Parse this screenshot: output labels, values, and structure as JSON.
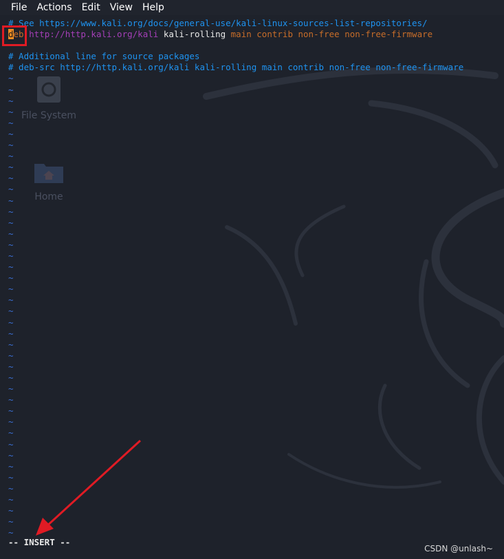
{
  "menubar": {
    "items": [
      "File",
      "Actions",
      "Edit",
      "View",
      "Help"
    ]
  },
  "desktop": {
    "icons": [
      {
        "label": "File System",
        "icon": "disc-icon"
      },
      {
        "label": "Home",
        "icon": "home-folder-icon"
      }
    ]
  },
  "editor": {
    "line1": {
      "prefix": "# See ",
      "link": "https://www.kali.org/docs/general-use/kali-linux-sources-list-repositories/"
    },
    "line2": {
      "cursor_char": "d",
      "keyword_rest": "eb",
      "url": "http://http.kali.org/kali",
      "suite": "kali-rolling",
      "components": "main contrib non-free non-free-firmware"
    },
    "line4": "# Additional line for source packages",
    "line5": "# deb-src http://http.kali.org/kali kali-rolling main contrib non-free non-free-firmware",
    "tilde_char": "~",
    "empty_line_count": 42
  },
  "status": {
    "mode": "-- INSERT --"
  },
  "watermark": "CSDN @unlash~",
  "colors": {
    "background": "#1e222b",
    "comment": "#1e93f0",
    "keyword": "#c76d29",
    "url": "#a53fb8",
    "cursor": "#f08c22",
    "tilde": "#3b6fd4",
    "annotation": "#e01b24"
  }
}
